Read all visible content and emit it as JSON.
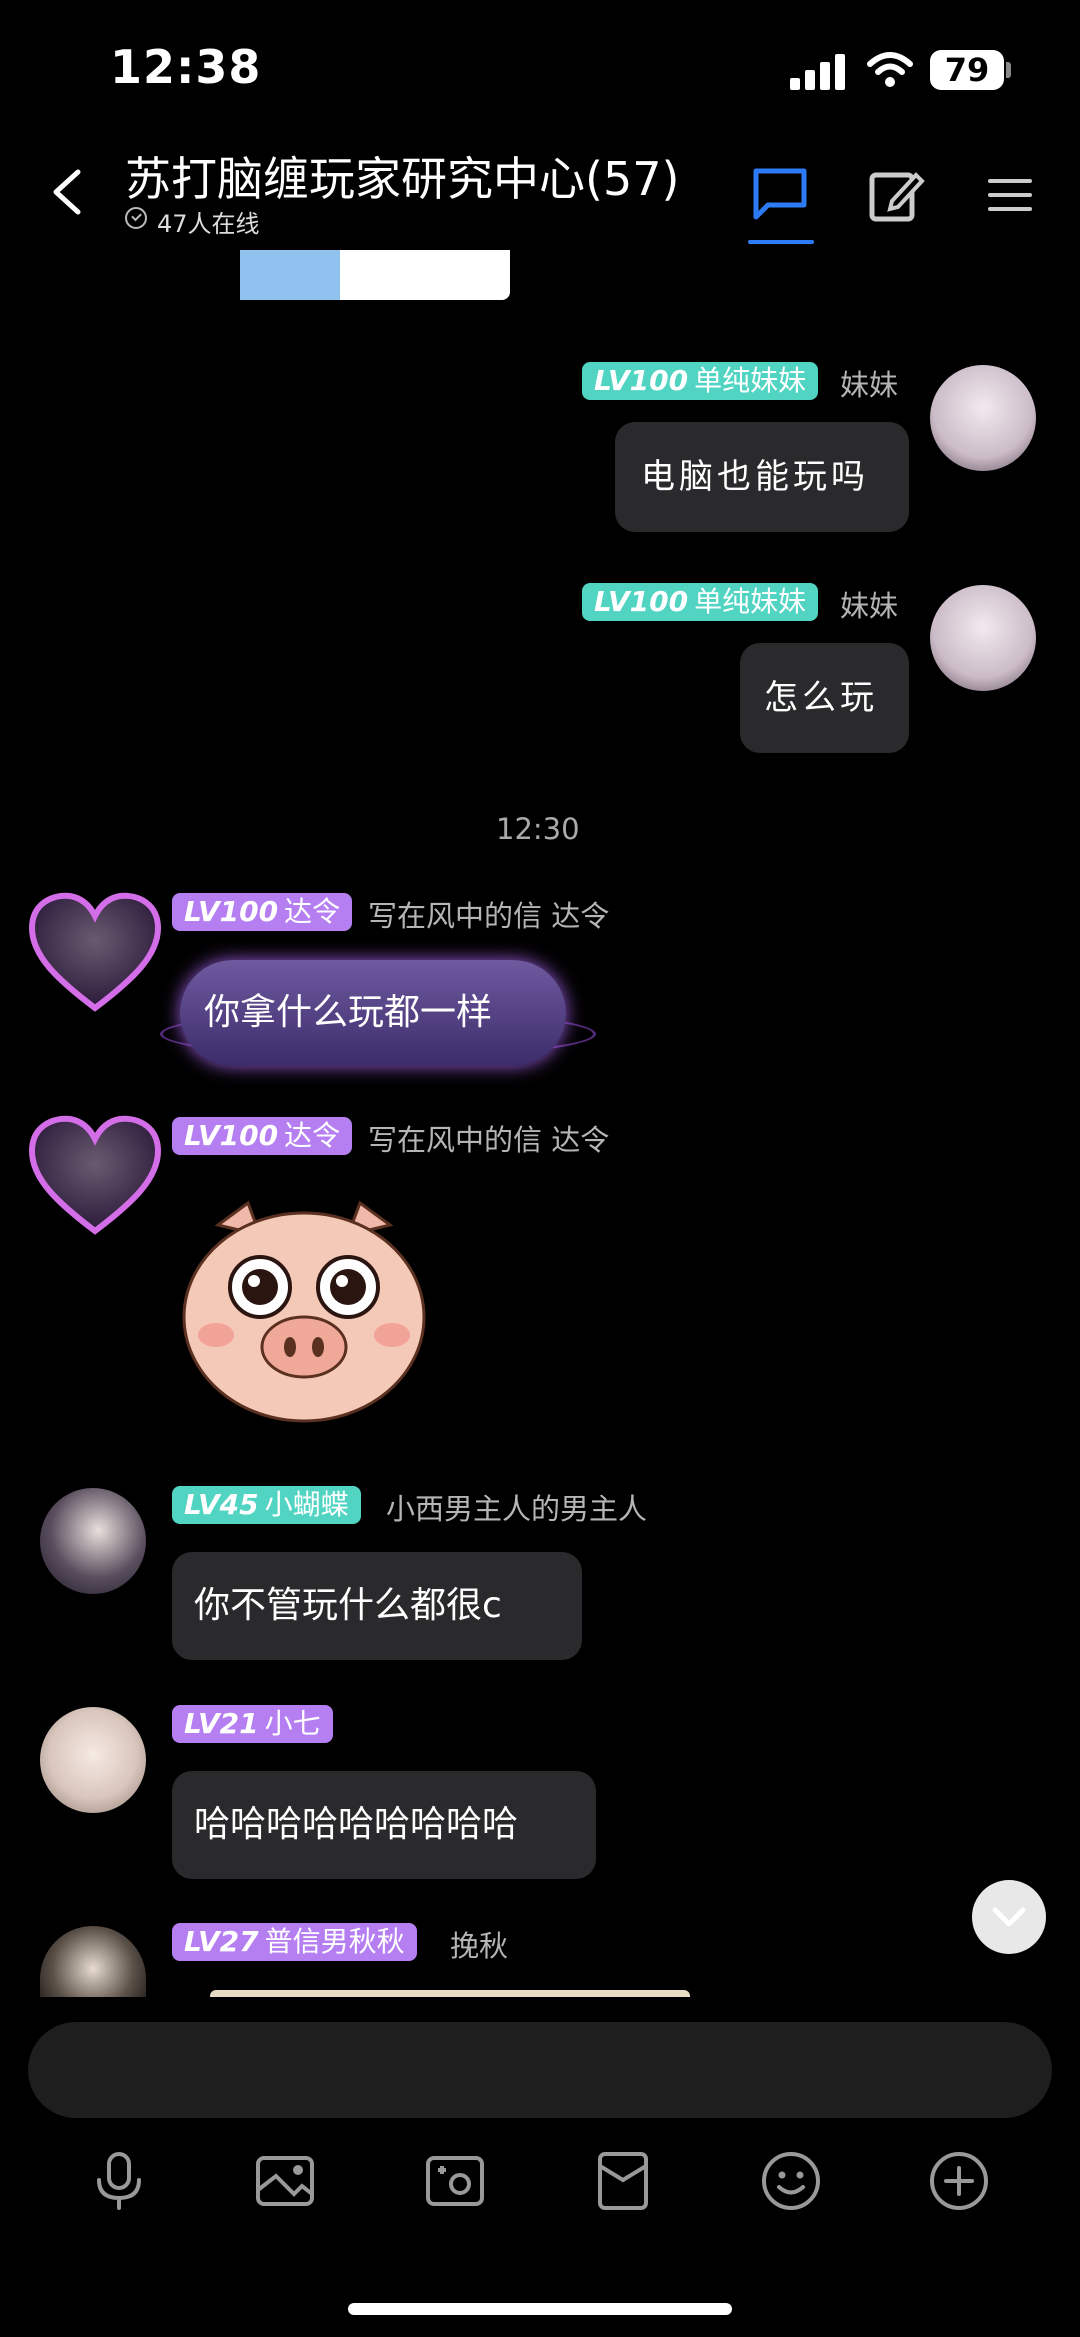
{
  "status_bar": {
    "time": "12:38",
    "battery": "79"
  },
  "header": {
    "title": "苏打脑缠玩家研究中心(57)",
    "online": "47人在线"
  },
  "messages": [
    {
      "level": "LV100",
      "title": "单纯妹妹",
      "nick": "妹妹",
      "text": "电脑也能玩吗"
    },
    {
      "level": "LV100",
      "title": "单纯妹妹",
      "nick": "妹妹",
      "text": "怎么玩"
    },
    {
      "level": "LV100",
      "title": "达令",
      "nick": "写在风中的信  达令",
      "text": "你拿什么玩都一样"
    },
    {
      "level": "LV100",
      "title": "达令",
      "nick": "写在风中的信  达令"
    },
    {
      "level": "LV45",
      "title": "小蝴蝶",
      "nick": "小西男主人的男主人",
      "text": "你不管玩什么都很c"
    },
    {
      "level": "LV21",
      "title": "小七",
      "text": "哈哈哈哈哈哈哈哈哈"
    },
    {
      "level": "LV27",
      "title": "普信男秋秋",
      "nick": "挽秋"
    }
  ],
  "timestamp": "12:30",
  "colors": {
    "accent_blue": "#2d7cf6",
    "badge_teal": "#52d4c3",
    "badge_purple": "#b57ff2",
    "bubble_bg": "#2a2a2c"
  },
  "toolbar_icons": [
    "microphone-icon",
    "image-icon",
    "camera-icon",
    "red-packet-icon",
    "emoji-icon",
    "plus-icon"
  ]
}
